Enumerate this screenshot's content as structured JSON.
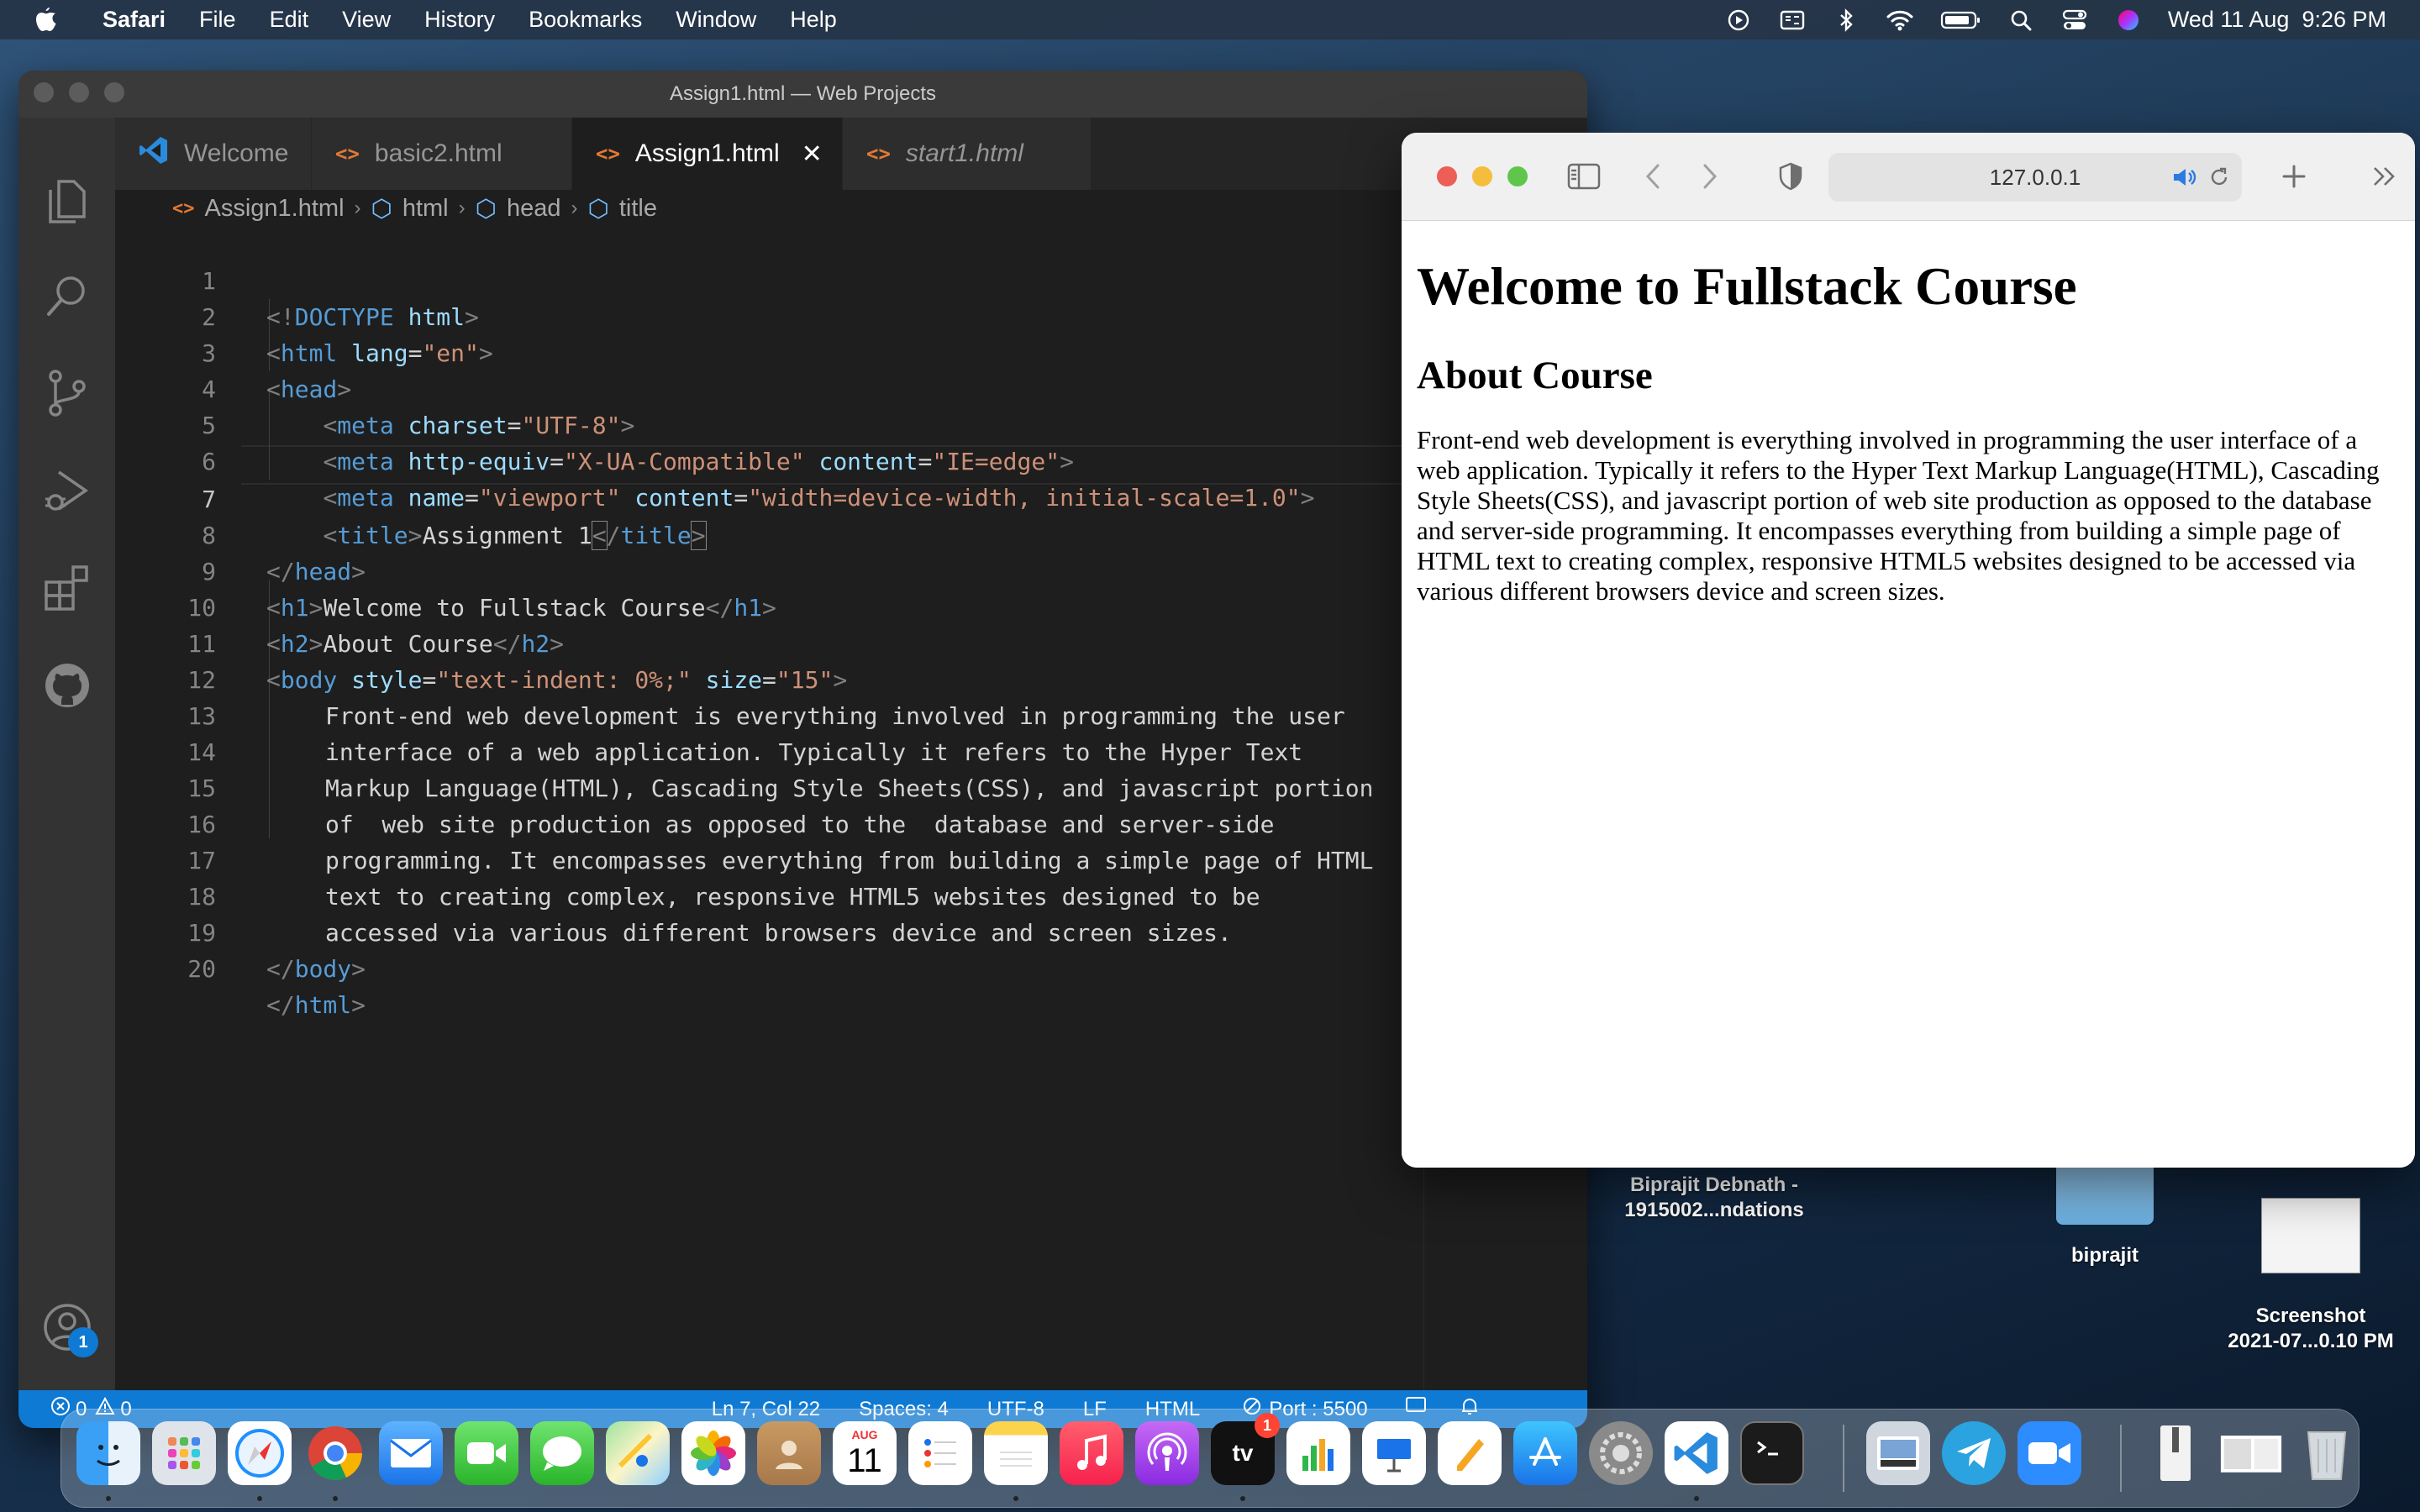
{
  "menubar": {
    "app_name": "Safari",
    "items": [
      "File",
      "Edit",
      "View",
      "History",
      "Bookmarks",
      "Window",
      "Help"
    ],
    "datetime": "Wed 11 Aug  9:26 PM"
  },
  "desktop": {
    "items": [
      {
        "label_line1": "Biprajit Debnath -",
        "label_line2": "1915002...ndations"
      },
      {
        "label_line1": "biprajit",
        "label_line2": ""
      },
      {
        "label_line1": "Screenshot",
        "label_line2": "2021-07...0.10 PM"
      }
    ]
  },
  "vscode": {
    "title": "Assign1.html — Web Projects",
    "tabs": [
      {
        "label": "Welcome",
        "icon": "vscode-logo-icon"
      },
      {
        "label": "basic2.html",
        "icon": "html-file-icon"
      },
      {
        "label": "Assign1.html",
        "icon": "html-file-icon",
        "active": true
      },
      {
        "label": "start1.html",
        "icon": "html-file-icon",
        "preview": true
      }
    ],
    "breadcrumb": [
      "Assign1.html",
      "html",
      "head",
      "title"
    ],
    "line_numbers": [
      "1",
      "2",
      "3",
      "4",
      "5",
      "6",
      "7",
      "8",
      "9",
      "10",
      "11",
      "12",
      "13",
      "14",
      "15",
      "16",
      "17",
      "18",
      "19",
      "20"
    ],
    "current_line": 7,
    "code": {
      "l1_doctype": "DOCTYPE",
      "l1_html": "html",
      "l2_tag": "html",
      "l2_attr": "lang",
      "l2_val": "\"en\"",
      "l3_tag": "head",
      "meta": "meta",
      "l4_attr": "charset",
      "l4_val": "\"UTF-8\"",
      "l5_attr1": "http-equiv",
      "l5_val1": "\"X-UA-Compatible\"",
      "l5_attr2": "content",
      "l5_val2": "\"IE=edge\"",
      "l6_attr1": "name",
      "l6_val1": "\"viewport\"",
      "l6_attr2": "content",
      "l6_val2": "\"width=device-width, initial-scale=1.0\"",
      "title_tag": "title",
      "l7_text": "Assignment 1",
      "l9_tag": "h1",
      "l9_text": "Welcome to Fullstack Course",
      "l10_tag": "h2",
      "l10_text": "About Course",
      "body_tag": "body",
      "l11_attr1": "style",
      "l11_val1": "\"text-indent: 0%;\"",
      "l11_attr2": "size",
      "l11_val2": "\"15\"",
      "l12": "Front-end web development is everything involved in programming the user",
      "l13": "interface of a web application. Typically it refers to the Hyper Text",
      "l14": "Markup Language(HTML), Cascading Style Sheets(CSS), and javascript portion",
      "l15": "of  web site production as opposed to the  database and server-side",
      "l16": "programming. It encompasses everything from building a simple page of HTML",
      "l17": "text to creating complex, responsive HTML5 websites designed to be",
      "l18": "accessed via various different browsers device and screen sizes."
    },
    "statusbar": {
      "errors": "0",
      "warnings": "0",
      "position": "Ln 7, Col 22",
      "spaces": "Spaces: 4",
      "encoding": "UTF-8",
      "eol": "LF",
      "language": "HTML",
      "port": "Port : 5500"
    },
    "accounts_badge": "1"
  },
  "safari": {
    "url": "127.0.0.1",
    "page": {
      "h1": "Welcome to Fullstack Course",
      "h2": "About Course",
      "paragraph": "Front-end web development is everything involved in programming the user interface of a web application. Typically it refers to the Hyper Text Markup Language(HTML), Cascading Style Sheets(CSS), and javascript portion of web site production as opposed to the database and server-side programming. It encompasses everything from building a simple page of HTML text to creating complex, responsive HTML5 websites designed to be accessed via various different browsers device and screen sizes."
    }
  },
  "dock": {
    "calendar_month": "AUG",
    "calendar_day": "11",
    "appletv_badge": "1",
    "appletv_label": "tv",
    "apps": [
      "finder-icon",
      "launchpad-icon",
      "safari-icon",
      "chrome-icon",
      "mail-icon",
      "facetime-icon",
      "messages-icon",
      "maps-icon",
      "photos-icon",
      "contacts-icon",
      "calendar-icon",
      "reminders-icon",
      "notes-icon",
      "music-icon",
      "podcasts-icon",
      "appletv-icon",
      "numbers-icon",
      "keynote-icon",
      "pages-icon",
      "appstore-icon",
      "system-preferences-icon",
      "vscode-icon",
      "terminal-icon",
      "preview-icon",
      "telegram-icon",
      "zoom-icon",
      "archive-icon",
      "documents-icon",
      "trash-icon"
    ]
  },
  "colors": {
    "vscode_accent": "#0e7ad4",
    "html_icon": "#e37933",
    "tag_name": "#569cd6",
    "attr_name": "#9cdcfe",
    "attr_value": "#ce9178"
  }
}
